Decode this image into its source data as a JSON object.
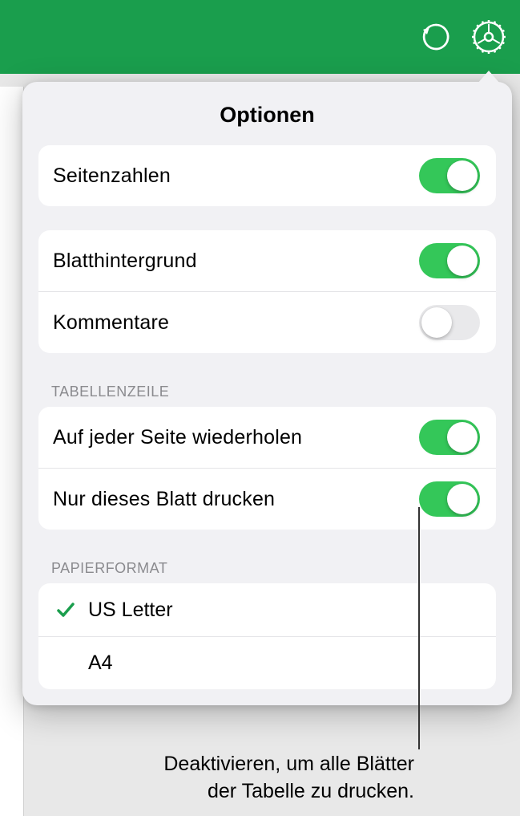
{
  "toolbar": {
    "undo_icon": "undo-icon",
    "settings_icon": "settings-gear-icon"
  },
  "popover": {
    "title": "Optionen",
    "pageNumbers": {
      "label": "Seitenzahlen",
      "on": true
    },
    "sheetBackground": {
      "label": "Blatthintergrund",
      "on": true
    },
    "comments": {
      "label": "Kommentare",
      "on": false
    },
    "tableRowHeader": "Tabellenzeile",
    "repeatEachPage": {
      "label": "Auf jeder Seite wiederholen",
      "on": true
    },
    "printThisSheetOnly": {
      "label": "Nur dieses Blatt drucken",
      "on": true
    },
    "paperFormatHeader": "Papierformat",
    "paperFormats": [
      {
        "label": "US Letter",
        "selected": true
      },
      {
        "label": "A4",
        "selected": false
      }
    ]
  },
  "callout": {
    "line1": "Deaktivieren, um alle Blätter",
    "line2": "der Tabelle zu drucken."
  }
}
